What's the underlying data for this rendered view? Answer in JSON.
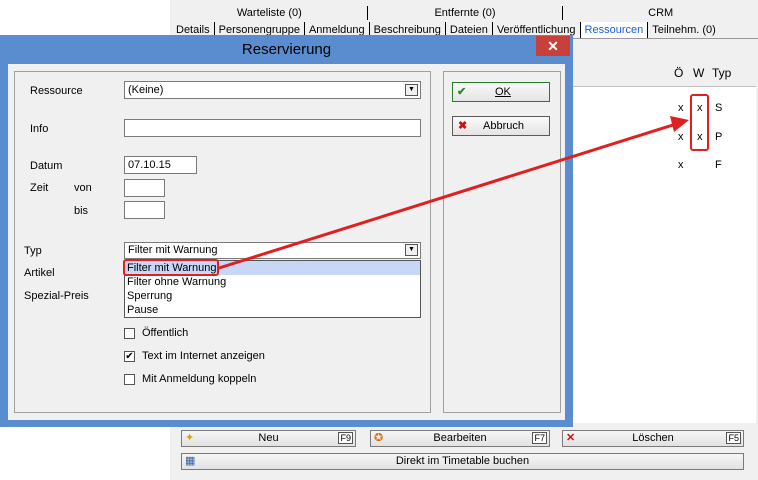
{
  "background": {
    "tabs_top": [
      "Warteliste (0)",
      "Entfernte (0)",
      "CRM"
    ],
    "tabs": [
      "Details",
      "Personengruppe",
      "Anmeldung",
      "Beschreibung",
      "Dateien",
      "Veröffentlichung",
      "Ressourcen",
      "Teilnehm. (0)"
    ],
    "active_tab": "Ressourcen",
    "columns": [
      "Ö",
      "W",
      "Typ"
    ],
    "rows": [
      {
        "o": "x",
        "w": "x",
        "typ": "S"
      },
      {
        "o": "x",
        "w": "x",
        "typ": "P"
      },
      {
        "o": "x",
        "w": "",
        "typ": "F"
      }
    ],
    "buttons": {
      "new": "Neu",
      "new_key": "F9",
      "edit": "Bearbeiten",
      "edit_key": "F7",
      "delete": "Löschen",
      "delete_key": "F5",
      "book": "Direkt im Timetable buchen"
    }
  },
  "dialog": {
    "title": "Reservierung",
    "close": "✕",
    "labels": {
      "resource": "Ressource",
      "info": "Info",
      "date": "Datum",
      "time": "Zeit",
      "from": "von",
      "to": "bis",
      "type": "Typ",
      "article": "Artikel",
      "special_price": "Spezial-Preis"
    },
    "values": {
      "resource": "(Keine)",
      "info": "",
      "date": "07.10.15",
      "from": "",
      "to": "",
      "type": "Filter mit Warnung"
    },
    "type_options": [
      "Filter mit Warnung",
      "Filter ohne Warnung",
      "Sperrung",
      "Pause"
    ],
    "checkboxes": [
      {
        "label": "Öffentlich",
        "checked": false,
        "mark": ""
      },
      {
        "label": "Text im Internet anzeigen",
        "checked": true,
        "mark": "✔"
      },
      {
        "label": "Mit Anmeldung koppeln",
        "checked": false,
        "mark": ""
      }
    ],
    "ok": "OK",
    "cancel": "Abbruch"
  },
  "colors": {
    "accent": "#5a8dcf",
    "close": "#c7403a",
    "highlight": "#e02020",
    "active_tab": "#1a5fd6"
  }
}
